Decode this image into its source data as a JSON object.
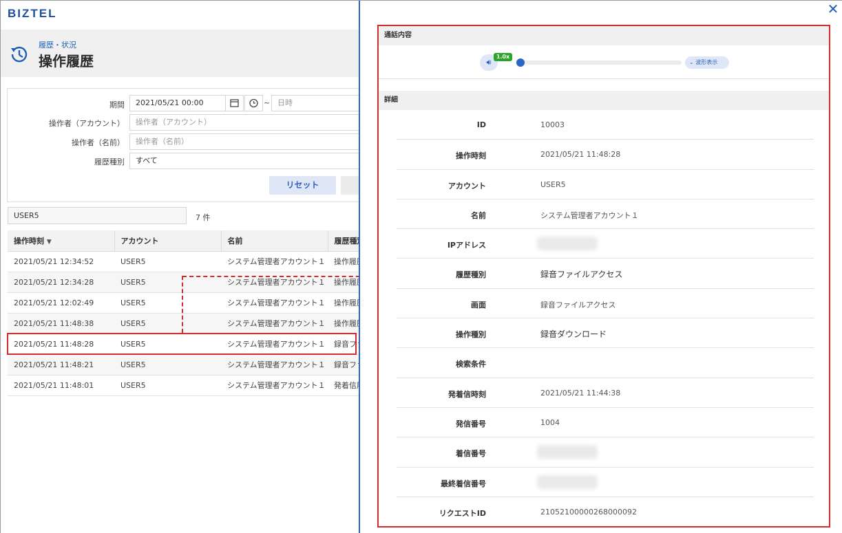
{
  "app": {
    "logo": "BIZTEL"
  },
  "page": {
    "breadcrumb": "履歴・状況",
    "title": "操作履歴"
  },
  "filters": {
    "period_label": "期間",
    "period_start": "2021/05/21 00:00",
    "period_tilde": "~",
    "period_end_placeholder": "日時",
    "operator_account_label": "操作者（アカウント）",
    "operator_account_placeholder": "操作者（アカウント）",
    "operator_name_label": "操作者（名前）",
    "operator_name_placeholder": "操作者（名前）",
    "history_type_label": "履歴種別",
    "history_type_value": "すべて",
    "reset_label": "リセット"
  },
  "results": {
    "quick_filter_value": "USER5",
    "count_text": "7 件",
    "columns": [
      "操作時刻",
      "アカウント",
      "名前",
      "履歴種別"
    ],
    "rows": [
      [
        "2021/05/21 12:34:52",
        "USER5",
        "システム管理者アカウント１",
        "操作履歴"
      ],
      [
        "2021/05/21 12:34:28",
        "USER5",
        "システム管理者アカウント１",
        "操作履歴"
      ],
      [
        "2021/05/21 12:02:49",
        "USER5",
        "システム管理者アカウント１",
        "操作履歴"
      ],
      [
        "2021/05/21 11:48:38",
        "USER5",
        "システム管理者アカウント１",
        "操作履歴"
      ],
      [
        "2021/05/21 11:48:28",
        "USER5",
        "システム管理者アカウント１",
        "録音ファイル"
      ],
      [
        "2021/05/21 11:48:21",
        "USER5",
        "システム管理者アカウント１",
        "録音ファイル"
      ],
      [
        "2021/05/21 11:48:01",
        "USER5",
        "システム管理者アカウント１",
        "発着信履歴"
      ]
    ],
    "selected_row": 4
  },
  "detail": {
    "call_section_title": "通話内容",
    "speed_badge": "1.0x",
    "wave_button": "波形表示",
    "detail_section_title": "詳細",
    "fields": [
      {
        "key": "ID",
        "value": "10003"
      },
      {
        "key": "操作時刻",
        "value": "2021/05/21 11:48:28"
      },
      {
        "key": "アカウント",
        "value": "USER5"
      },
      {
        "key": "名前",
        "value": "システム管理者アカウント１"
      },
      {
        "key": "IPアドレス",
        "value": ""
      },
      {
        "key": "履歴種別",
        "value": "録音ファイルアクセス"
      },
      {
        "key": "画面",
        "value": "録音ファイルアクセス"
      },
      {
        "key": "操作種別",
        "value": "録音ダウンロード"
      },
      {
        "key": "検索条件",
        "value": ""
      },
      {
        "key": "発着信時刻",
        "value": "2021/05/21 11:44:38"
      },
      {
        "key": "発信番号",
        "value": "1004"
      },
      {
        "key": "着信番号",
        "value": ""
      },
      {
        "key": "最終着信番号",
        "value": ""
      },
      {
        "key": "リクエストID",
        "value": "21052100000268000092"
      }
    ]
  },
  "colors": {
    "accent": "#1d5fb8",
    "highlight": "#d72a2a",
    "badge": "#2aa52a"
  }
}
